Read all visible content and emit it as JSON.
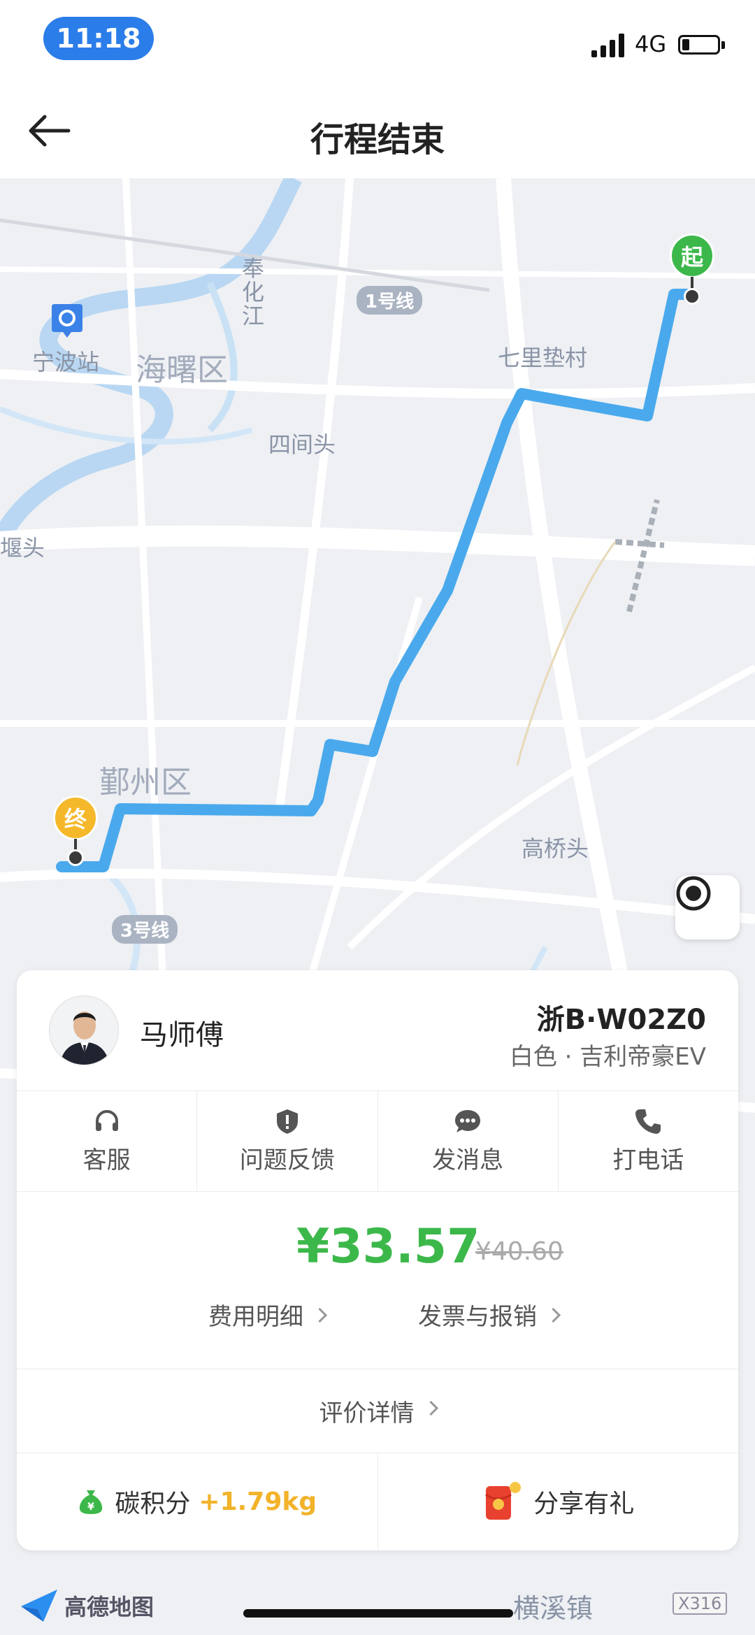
{
  "status": {
    "time": "11:18",
    "network": "4G"
  },
  "nav": {
    "title": "行程结束"
  },
  "map": {
    "route_color": "#4aa9ec",
    "labels": {
      "ningbo_station": "宁波站",
      "haishu": "海曙区",
      "fenghua_river": "奉化江",
      "qili": "七里垫村",
      "sijiantou": "四间头",
      "yantou": "堰头",
      "yinzhou": "鄞州区",
      "gaoqiaotou": "高桥头",
      "line1": "1号线",
      "line3": "3号线"
    },
    "start_pin": "起",
    "end_pin": "终"
  },
  "driver": {
    "name": "马师傅",
    "plate": "浙B·W02Z0",
    "car": "白色 · 吉利帝豪EV"
  },
  "actions": [
    {
      "label": "客服",
      "icon": "headset-icon"
    },
    {
      "label": "问题反馈",
      "icon": "shield-alert-icon"
    },
    {
      "label": "发消息",
      "icon": "chat-bubble-icon"
    },
    {
      "label": "打电话",
      "icon": "phone-icon"
    }
  ],
  "fare": {
    "price": "¥33.57",
    "original": "¥40.60",
    "detail_link": "费用明细",
    "invoice_link": "发票与报销"
  },
  "review": {
    "label": "评价详情"
  },
  "carbon": {
    "label": "碳积分",
    "value": "+1.79kg"
  },
  "share": {
    "label": "分享有礼"
  },
  "footer": {
    "brand": "高德地图",
    "town": "横溪镇",
    "road_badge": "X316"
  },
  "colors": {
    "accent_green": "#3cb84a",
    "carbon_gold": "#f2b22a",
    "status_blue": "#2b7de9"
  }
}
